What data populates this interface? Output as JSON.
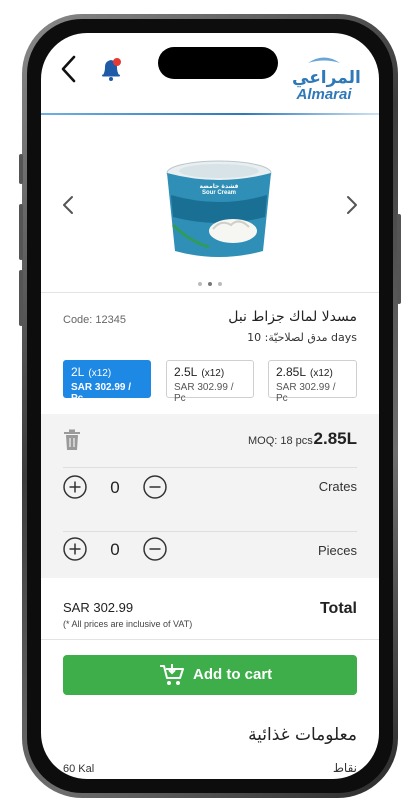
{
  "header": {
    "brand_ar": "المراعي",
    "brand_en": "Almarai",
    "notification_dot_color": "#e53935",
    "accent_color": "#2f79b9"
  },
  "carousel": {
    "product_label_ar": "قشدة حامضة",
    "product_label_en": "Sour Cream",
    "dots": [
      false,
      true,
      false
    ]
  },
  "product": {
    "code": "Code: 12345",
    "title": "مسدلا لماك جزاط نبل",
    "shelf_life": "مدق لصلاحيّة: 10 days"
  },
  "variants": [
    {
      "size": "2L",
      "multiplier": "(x12)",
      "price": "SAR 302.99 / Pc",
      "selected": true
    },
    {
      "size": "2.5L",
      "multiplier": "(x12)",
      "price": "SAR 302.99 / Pc",
      "selected": false
    },
    {
      "size": "2.85L",
      "multiplier": "(x12)",
      "price": "SAR 302.99 / Pc",
      "selected": false
    }
  ],
  "order": {
    "moq": "MOQ: 18 pcs",
    "moq_size": "2.85L",
    "crates_qty": "0",
    "crates_label": "Crates",
    "pieces_qty": "0",
    "pieces_label": "Pieces"
  },
  "total": {
    "price": "SAR 302.99",
    "vat_note": "(* All prices are inclusive of VAT)",
    "label": "Total"
  },
  "cart": {
    "label": "Add to cart",
    "color": "#3dae4a"
  },
  "nutrition": {
    "title": "معلومات غذائية",
    "calories": "60 Kal",
    "points": "نقاط"
  },
  "selected_variant_color": "#1e88e5"
}
